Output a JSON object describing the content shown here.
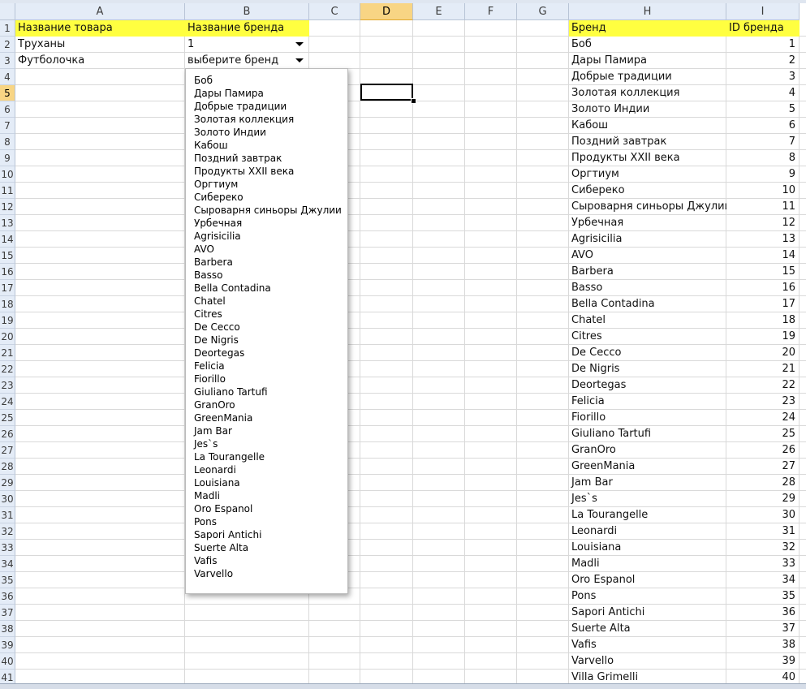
{
  "columns": [
    "A",
    "B",
    "C",
    "D",
    "E",
    "F",
    "G",
    "H",
    "I"
  ],
  "selected_column": "D",
  "selected_row": 5,
  "row_numbers": [
    1,
    2,
    3,
    4,
    5,
    6,
    7,
    8,
    9,
    10,
    11,
    12,
    13,
    14,
    15,
    16,
    17,
    18,
    19,
    20,
    21,
    22,
    23,
    24,
    25,
    26,
    27,
    28,
    29,
    30,
    31,
    32,
    33,
    34,
    35,
    36,
    37,
    38,
    39,
    40,
    41
  ],
  "left_table": {
    "header_product": "Название товара",
    "header_brand": "Название бренда",
    "rows": [
      {
        "product": "Труханы",
        "brand": "1"
      },
      {
        "product": "Футболочка",
        "brand": "выберите бренд"
      }
    ]
  },
  "right_table": {
    "header_brand": "Бренд",
    "header_id": "ID бренда",
    "rows": [
      {
        "brand": "Боб",
        "id": "1"
      },
      {
        "brand": "Дары Памира",
        "id": "2"
      },
      {
        "brand": "Добрые традиции",
        "id": "3"
      },
      {
        "brand": "Золотая коллекция",
        "id": "4"
      },
      {
        "brand": "Золото Индии",
        "id": "5"
      },
      {
        "brand": "Кабош",
        "id": "6"
      },
      {
        "brand": "Поздний завтрак",
        "id": "7"
      },
      {
        "brand": "Продукты XXII века",
        "id": "8"
      },
      {
        "brand": "Оргтиум",
        "id": "9"
      },
      {
        "brand": "Сибереко",
        "id": "10"
      },
      {
        "brand": "Сыроварня синьоры Джулии",
        "id": "11"
      },
      {
        "brand": "Урбечная",
        "id": "12"
      },
      {
        "brand": "Agrisicilia",
        "id": "13"
      },
      {
        "brand": "AVO",
        "id": "14"
      },
      {
        "brand": "Barbera",
        "id": "15"
      },
      {
        "brand": "Basso",
        "id": "16"
      },
      {
        "brand": "Bella Contadina",
        "id": "17"
      },
      {
        "brand": "Chatel",
        "id": "18"
      },
      {
        "brand": "Citres",
        "id": "19"
      },
      {
        "brand": "De Cecco",
        "id": "20"
      },
      {
        "brand": "De Nigris",
        "id": "21"
      },
      {
        "brand": "Deortegas",
        "id": "22"
      },
      {
        "brand": "Felicia",
        "id": "23"
      },
      {
        "brand": "Fiorillo",
        "id": "24"
      },
      {
        "brand": "Giuliano Tartufi",
        "id": "25"
      },
      {
        "brand": "GranOro",
        "id": "26"
      },
      {
        "brand": "GreenMania",
        "id": "27"
      },
      {
        "brand": "Jam Bar",
        "id": "28"
      },
      {
        "brand": "Jes`s",
        "id": "29"
      },
      {
        "brand": "La Tourangelle",
        "id": "30"
      },
      {
        "brand": "Leonardi",
        "id": "31"
      },
      {
        "brand": "Louisiana",
        "id": "32"
      },
      {
        "brand": "Madli",
        "id": "33"
      },
      {
        "brand": "Oro Espanol",
        "id": "34"
      },
      {
        "brand": "Pons",
        "id": "35"
      },
      {
        "brand": "Sapori Antichi",
        "id": "36"
      },
      {
        "brand": "Suerte Alta",
        "id": "37"
      },
      {
        "brand": "Vafis",
        "id": "38"
      },
      {
        "brand": "Varvello",
        "id": "39"
      },
      {
        "brand": "Villa Grimelli",
        "id": "40"
      }
    ]
  },
  "dropdown_items": [
    "Боб",
    "Дары Памира",
    "Добрые традиции",
    "Золотая коллекция",
    "Золото Индии",
    "Кабош",
    "Поздний завтрак",
    "Продукты XXII века",
    "Оргтиум",
    "Сибереко",
    "Сыроварня синьоры Джулии",
    "Урбечная",
    "Agrisicilia",
    "AVO",
    "Barbera",
    "Basso",
    "Bella Contadina",
    "Chatel",
    "Citres",
    "De Cecco",
    "De Nigris",
    "Deortegas",
    "Felicia",
    "Fiorillo",
    "Giuliano Tartufi",
    "GranOro",
    "GreenMania",
    "Jam Bar",
    "Jes`s",
    "La Tourangelle",
    "Leonardi",
    "Louisiana",
    "Madli",
    "Oro Espanol",
    "Pons",
    "Sapori Antichi",
    "Suerte Alta",
    "Vafis",
    "Varvello"
  ],
  "colors": {
    "header_yellow": "#ffff40",
    "selected_header": "#f8d584",
    "header_bg": "#e4ecf7"
  }
}
